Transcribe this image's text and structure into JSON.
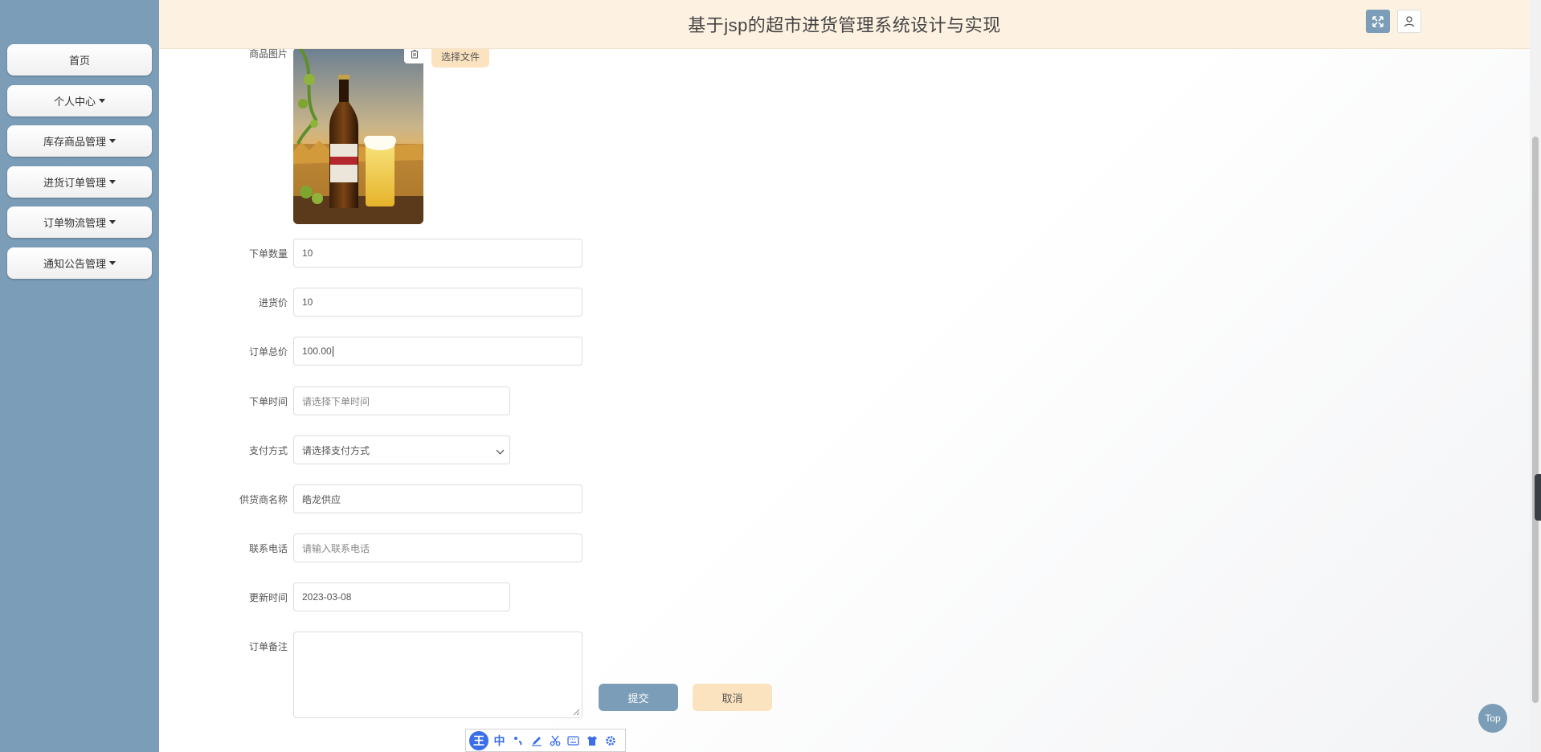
{
  "header": {
    "title": "基于jsp的超市进货管理系统设计与实现"
  },
  "sidebar": {
    "items": [
      {
        "label": "首页",
        "has_dropdown": false
      },
      {
        "label": "个人中心",
        "has_dropdown": true
      },
      {
        "label": "库存商品管理",
        "has_dropdown": true
      },
      {
        "label": "进货订单管理",
        "has_dropdown": true
      },
      {
        "label": "订单物流管理",
        "has_dropdown": true
      },
      {
        "label": "通知公告管理",
        "has_dropdown": true
      }
    ]
  },
  "form": {
    "image_label": "商品图片",
    "upload_label": "选择文件",
    "quantity": {
      "label": "下单数量",
      "value": "10"
    },
    "purchase_price": {
      "label": "进货价",
      "value": "10"
    },
    "total_price": {
      "label": "订单总价",
      "value": "100.00"
    },
    "order_time": {
      "label": "下单时间",
      "placeholder": "请选择下单时间"
    },
    "payment_method": {
      "label": "支付方式",
      "selected": "请选择支付方式"
    },
    "supplier_name": {
      "label": "供货商名称",
      "value": "皓龙供应"
    },
    "contact_phone": {
      "label": "联系电话",
      "placeholder": "请输入联系电话"
    },
    "update_time": {
      "label": "更新时间",
      "value": "2023-03-08"
    },
    "order_note": {
      "label": "订单备注",
      "value": ""
    },
    "submit_label": "提交",
    "cancel_label": "取消"
  },
  "ime_bar": {
    "logo": "王",
    "lang": "中"
  },
  "top_button": {
    "label": "Top"
  },
  "colors": {
    "sidebar": "#7b9db7",
    "header": "#fdf1e1",
    "accent_orange": "#fce3c0",
    "primary": "#7b9db7"
  },
  "icons": [
    "expand-icon",
    "user-icon",
    "trash-icon",
    "chevron-down-icon",
    "text-cursor-icon"
  ]
}
